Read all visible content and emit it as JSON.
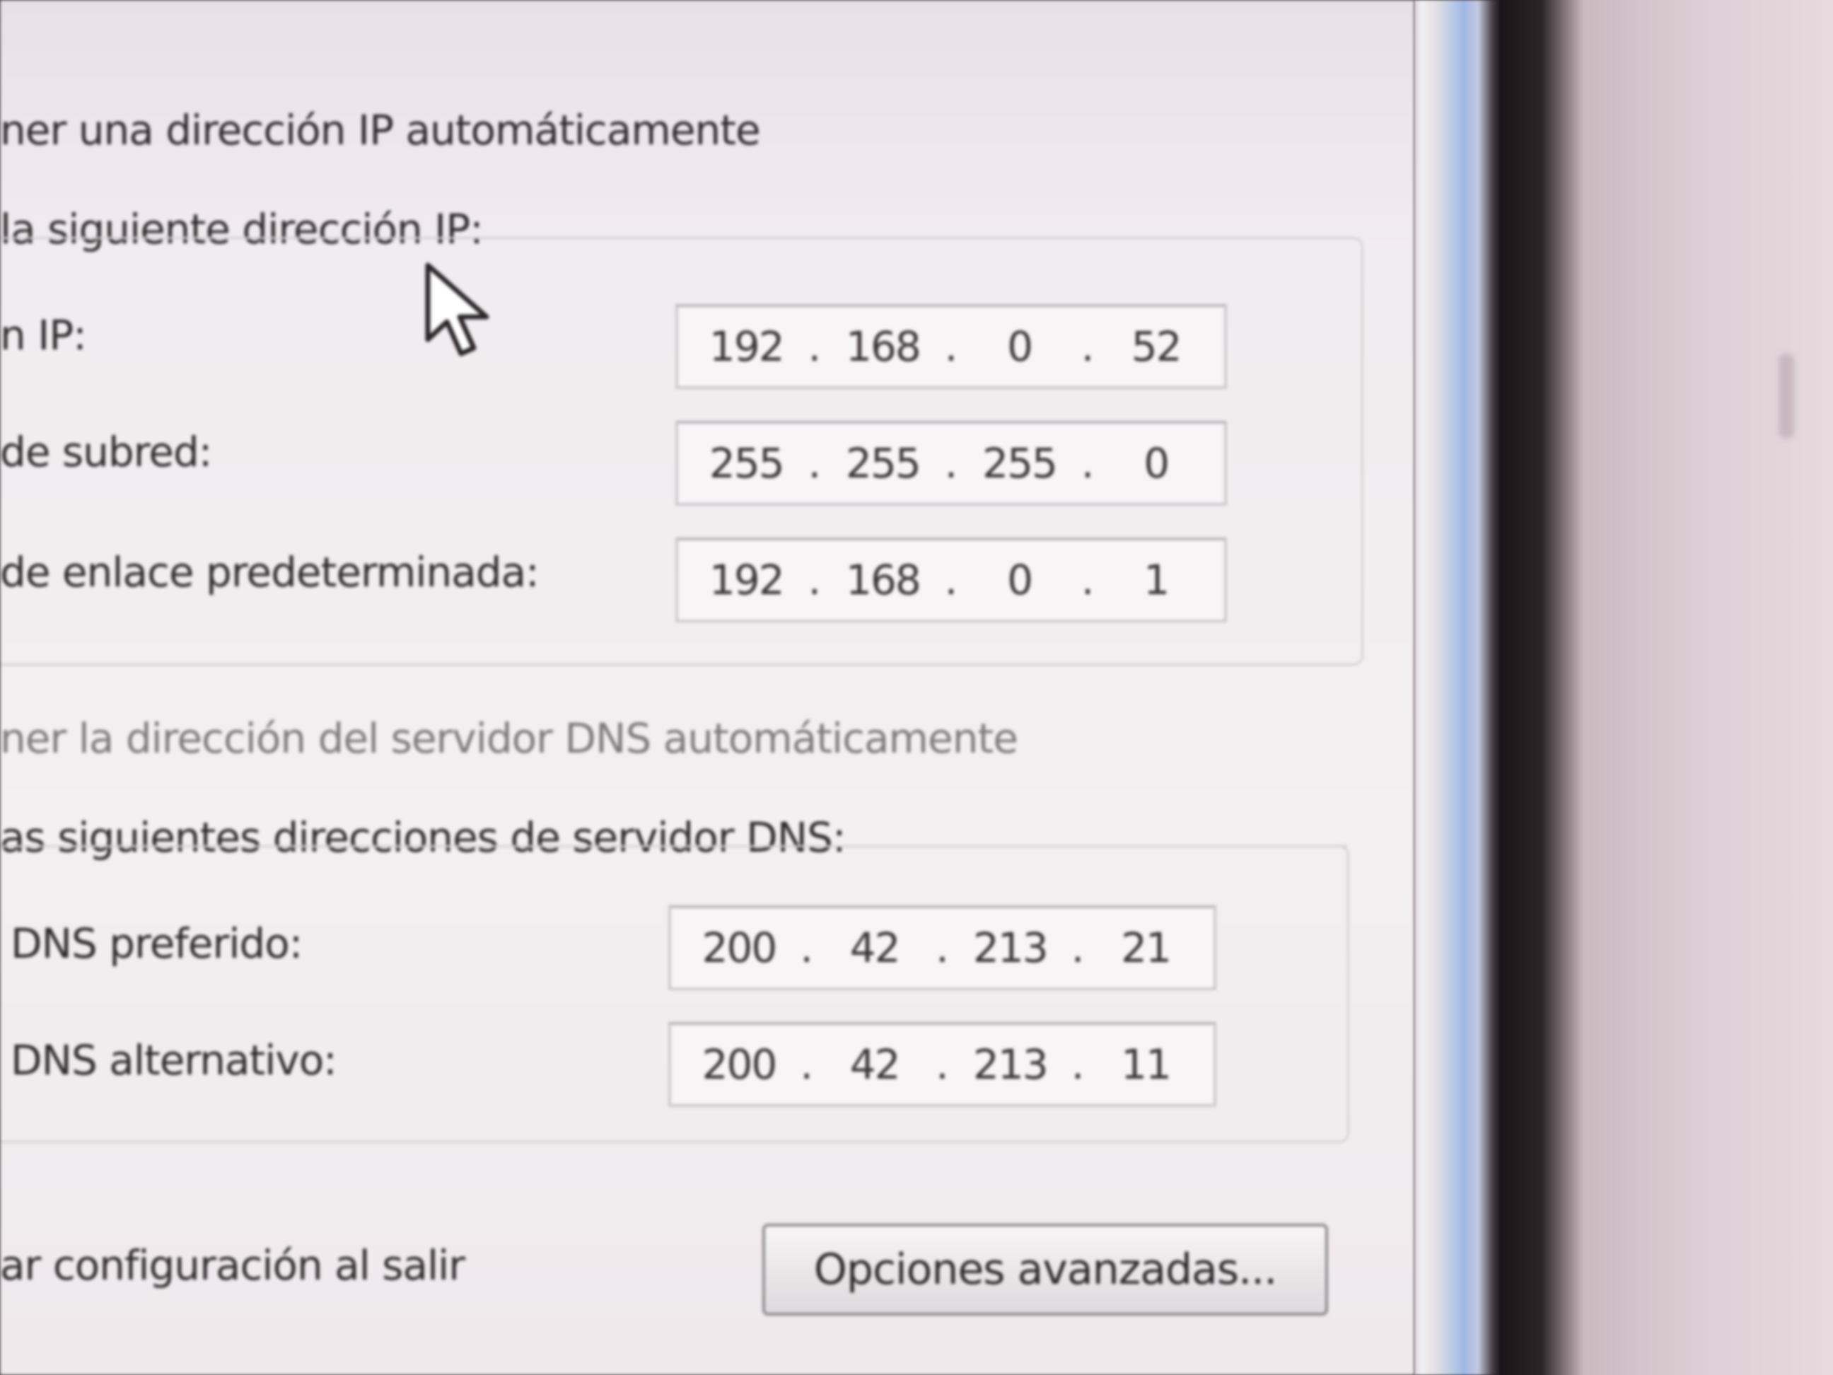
{
  "dialog": {
    "radio_ip_auto": "ner una dirección IP automáticamente",
    "radio_ip_manual": "la siguiente dirección IP:",
    "fields": {
      "ip_address": {
        "label": "n IP:",
        "octets": [
          "192",
          "168",
          "0",
          "52"
        ]
      },
      "subnet_mask": {
        "label": "de subred:",
        "octets": [
          "255",
          "255",
          "255",
          "0"
        ]
      },
      "gateway": {
        "label": "de enlace predeterminada:",
        "octets": [
          "192",
          "168",
          "0",
          "1"
        ]
      }
    },
    "radio_dns_auto": "ner la dirección del servidor DNS automáticamente",
    "radio_dns_manual": "as siguientes direcciones de servidor DNS:",
    "dns": {
      "preferred": {
        "label": "DNS preferido:",
        "octets": [
          "200",
          "42",
          "213",
          "21"
        ]
      },
      "alternate": {
        "label": "DNS alternativo:",
        "octets": [
          "200",
          "42",
          "213",
          "11"
        ]
      }
    },
    "validate_on_exit": "ar configuración al salir",
    "advanced_button": "Opciones avanzadas..."
  }
}
